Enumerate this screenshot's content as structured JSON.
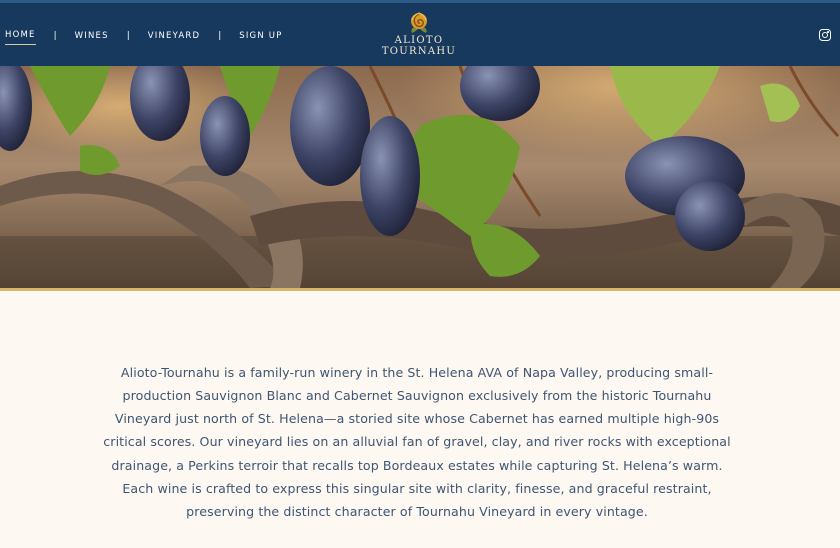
{
  "nav": {
    "items": [
      {
        "label": "HOME",
        "active": true
      },
      {
        "label": "WINES"
      },
      {
        "label": "VINEYARD"
      },
      {
        "label": "SIGN UP"
      }
    ],
    "separator": "|"
  },
  "logo": {
    "line1": "ALIOTO",
    "line2": "TOURNAHU",
    "emblem": "rose-icon"
  },
  "social": {
    "icon": "instagram-icon"
  },
  "hero": {
    "image": "vineyard-grapes-photo"
  },
  "intro": {
    "text": "Alioto-Tournahu is a family-run winery in the St. Helena AVA of Napa Valley, producing small-production Sauvignon Blanc and Cabernet Sauvignon exclusively from the historic Tournahu Vineyard just north of St. Helena—a storied site whose Cabernet has earned multiple high-90s critical scores. Our vineyard lies on an alluvial fan of gravel, clay, and river rocks with exceptional drainage, a Perkins terroir that recalls top Bordeaux estates while capturing St. Helena’s warm. Each wine is crafted to express this singular site with clarity, finesse, and graceful restraint, preserving the distinct character of Tournahu Vineyard in every vintage."
  },
  "colors": {
    "header": "#18395e",
    "accent": "#d5b56a",
    "background": "#fdf8f1",
    "text": "#3f5573"
  }
}
